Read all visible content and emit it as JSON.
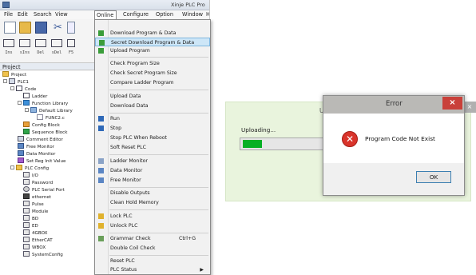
{
  "app": {
    "title": "Xinje PLC Pro"
  },
  "menubar": {
    "items": [
      "File",
      "Edit",
      "Search",
      "View",
      "Online",
      "Configure",
      "Option",
      "Window",
      "H"
    ]
  },
  "toolbar": {
    "insert_labels": [
      "Ins",
      "sIns",
      "Del",
      "sDel",
      "F5"
    ]
  },
  "project": {
    "panel_title": "Project",
    "tree": [
      {
        "label": "Project",
        "icon": "project-icon"
      },
      {
        "label": "PLC1",
        "icon": "plc-icon"
      },
      {
        "label": "Code",
        "icon": "code-icon"
      },
      {
        "label": "Ladder",
        "icon": "ladder-icon"
      },
      {
        "label": "Function Library",
        "icon": "function-library-icon"
      },
      {
        "label": "Default Library",
        "icon": "library-icon"
      },
      {
        "label": "FUNC2.c",
        "icon": "c-file-icon"
      },
      {
        "label": "Config Block",
        "icon": "config-block-icon"
      },
      {
        "label": "Sequence Block",
        "icon": "sequence-block-icon"
      },
      {
        "label": "Comment Editor",
        "icon": "comment-editor-icon"
      },
      {
        "label": "Free Monitor",
        "icon": "free-monitor-icon"
      },
      {
        "label": "Data Monitor",
        "icon": "data-monitor-icon"
      },
      {
        "label": "Set Reg Init Value",
        "icon": "register-icon"
      },
      {
        "label": "PLC Config",
        "icon": "folder-icon"
      },
      {
        "label": "I/O",
        "icon": "io-icon"
      },
      {
        "label": "Password",
        "icon": "password-icon"
      },
      {
        "label": "PLC Serial Port",
        "icon": "serial-port-icon"
      },
      {
        "label": "ethernet",
        "icon": "ethernet-icon"
      },
      {
        "label": "Pulse",
        "icon": "pulse-icon"
      },
      {
        "label": "Module",
        "icon": "module-icon"
      },
      {
        "label": "BD",
        "icon": "bd-icon"
      },
      {
        "label": "ED",
        "icon": "ed-icon"
      },
      {
        "label": "4GBOX",
        "icon": "4gbox-icon"
      },
      {
        "label": "EtherCAT",
        "icon": "ethercat-icon"
      },
      {
        "label": "WBOX",
        "icon": "wbox-icon"
      },
      {
        "label": "SystemConfig",
        "icon": "system-config-icon"
      }
    ]
  },
  "online_menu": {
    "items": [
      {
        "label": "Download Program & Data",
        "icon": "download-icon"
      },
      {
        "label": "Secret Download Program & Data",
        "icon": "secret-download-icon",
        "highlighted": true
      },
      {
        "label": "Upload Program",
        "icon": "upload-icon"
      },
      {
        "label": "Check Program Size"
      },
      {
        "label": "Check Secret Program Size"
      },
      {
        "label": "Compare Ladder Program"
      },
      {
        "label": "Upload Data"
      },
      {
        "label": "Download Data"
      },
      {
        "label": "Run",
        "icon": "run-icon"
      },
      {
        "label": "Stop",
        "icon": "stop-icon"
      },
      {
        "label": "Stop PLC When Reboot"
      },
      {
        "label": "Soft Reset PLC"
      },
      {
        "label": "Ladder Monitor",
        "icon": "ladder-monitor-icon"
      },
      {
        "label": "Data Monitor",
        "icon": "data-monitor-icon"
      },
      {
        "label": "Free Monitor",
        "icon": "free-monitor-icon"
      },
      {
        "label": "Disable Outputs"
      },
      {
        "label": "Clean Hold Memory"
      },
      {
        "label": "Lock PLC",
        "icon": "lock-icon"
      },
      {
        "label": "Unlock PLC",
        "icon": "unlock-icon"
      },
      {
        "label": "Grammar Check",
        "shortcut": "Ctrl+G",
        "icon": "grammar-check-icon"
      },
      {
        "label": "Double Coil Check"
      },
      {
        "label": "Reset PLC"
      },
      {
        "label": "PLC Status",
        "submenu": true
      }
    ]
  },
  "upload_dialog": {
    "title": "U",
    "status_text": "Uploading...",
    "progress": 0.23
  },
  "error_dialog": {
    "title": "Error",
    "close_label": "×",
    "message": "Program Code Not Exist",
    "ok_label": "OK",
    "icon": "error-icon"
  },
  "colors": {
    "accent_highlight": "#cde6f7",
    "progress_fill": "#06b025",
    "close_red": "#c9403a",
    "upload_bg": "#e9f4dd"
  }
}
